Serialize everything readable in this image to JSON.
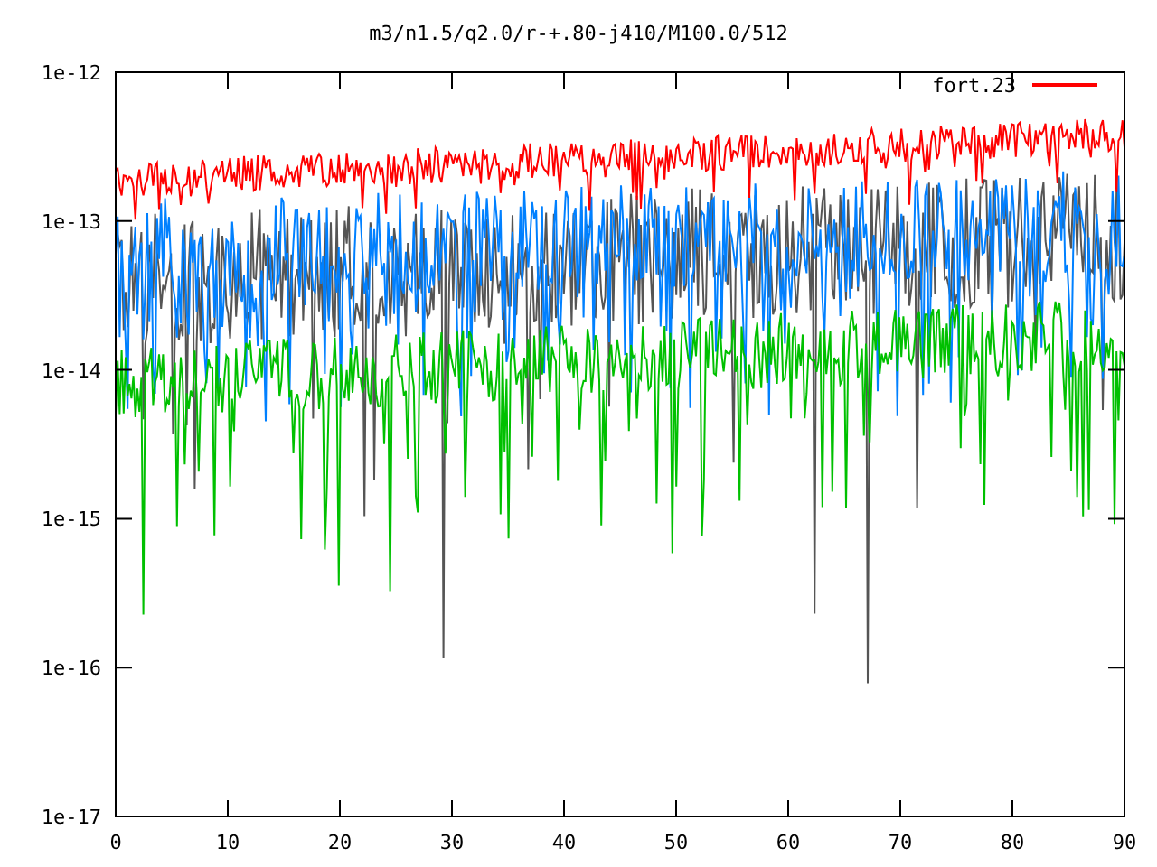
{
  "chart": {
    "title": "m3/n1.5/q2.0/r-+.80-j410/M100.0/512",
    "y_ticks": [
      "1e-12",
      "1e-13",
      "1e-14",
      "1e-15",
      "1e-16",
      "1e-17"
    ],
    "x_ticks": [
      "0",
      "10",
      "20",
      "30",
      "40",
      "50",
      "60",
      "70",
      "80",
      "90"
    ],
    "legend": {
      "label": "fort.23",
      "color": "#ff0000"
    },
    "traces": [
      {
        "color": "#555555"
      },
      {
        "color": "#0080ff"
      },
      {
        "color": "#00c000"
      },
      {
        "color": "#ff0000"
      }
    ]
  }
}
